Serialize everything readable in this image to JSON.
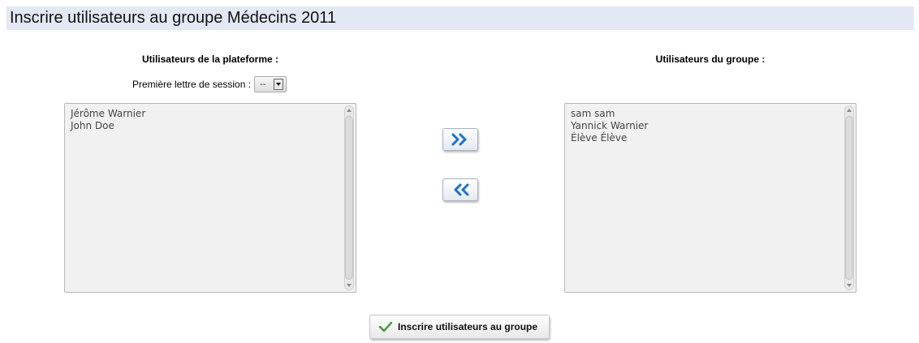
{
  "header": {
    "title": "Inscrire utilisateurs au groupe Médecins 2011"
  },
  "platform": {
    "title": "Utilisateurs de la plateforme :",
    "filter_label": "Première lettre de session :",
    "filter_value": "--",
    "users": [
      "Jérôme Warnier",
      "John Doe"
    ]
  },
  "group": {
    "title": "Utilisateurs du groupe :",
    "users": [
      "sam sam",
      "Yannick Warnier",
      "Élève Élève"
    ]
  },
  "actions": {
    "add_icon": "double-chevron-right-icon",
    "remove_icon": "double-chevron-left-icon",
    "submit_label": "Inscrire utilisateurs au groupe",
    "submit_icon": "checkmark-icon"
  },
  "colors": {
    "header_bg": "#e2e9f4",
    "arrow_blue": "#1c6fd6",
    "check_green": "#3c9a2e"
  }
}
